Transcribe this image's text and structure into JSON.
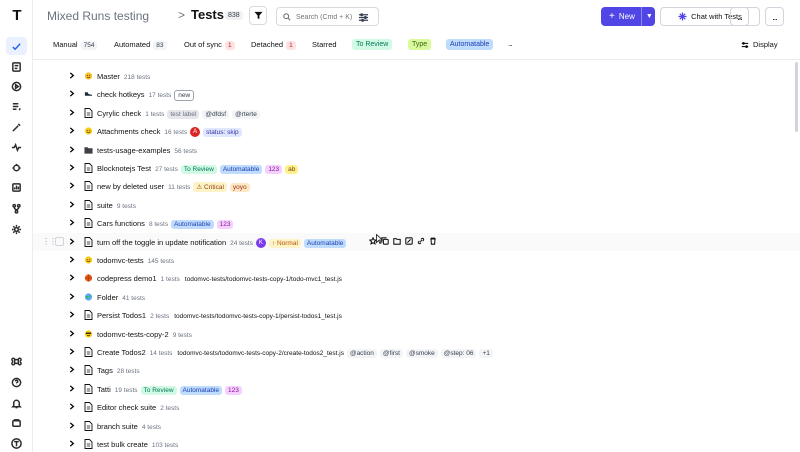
{
  "header": {
    "crumb": "Mixed Runs testing",
    "separator": ">",
    "title": "Tests",
    "count": "838",
    "search_placeholder": "Search (Cmd + K)",
    "new_label": "New",
    "chat_label": "Chat with Tests",
    "more_label": "...",
    "accent_color": "#4f46e5"
  },
  "rail": {
    "logo": "T",
    "items": [
      "check-icon",
      "clipboard-icon",
      "play-icon",
      "list-icon",
      "wand-icon",
      "pulse-icon",
      "bug-icon",
      "chart-icon",
      "branch-icon",
      "gear-icon"
    ],
    "bottom": [
      "command-icon",
      "help-icon",
      "bell-icon",
      "folders-icon",
      "user-logo-icon"
    ]
  },
  "tabs": [
    {
      "label": "Manual",
      "count": "754"
    },
    {
      "label": "Automated",
      "count": "83"
    },
    {
      "label": "Out of sync",
      "count": "1"
    },
    {
      "label": "Detached",
      "count": "1"
    },
    {
      "label": "Starred",
      "count": ""
    }
  ],
  "filters": [
    "To Review",
    "Type",
    "Automatable"
  ],
  "tabs_more": "...",
  "display_label": "Display",
  "rows": [
    {
      "icon": "sun-emoji-icon",
      "name": "Master",
      "meta": "218 tests",
      "tags": []
    },
    {
      "icon": "shoes-emoji-icon",
      "name": "check hotkeys",
      "meta": "17 tests",
      "tags": [
        "new"
      ]
    },
    {
      "icon": "file-icon",
      "name": "Cyrylic check",
      "meta": "1 tests",
      "tags": [
        "test label",
        "@dfdsf",
        "@rterte"
      ]
    },
    {
      "icon": "smile-emoji-icon",
      "name": "Attachments check",
      "meta": "16 tests",
      "avatar": "A",
      "tags": [
        "status: skip"
      ]
    },
    {
      "icon": "folder-icon",
      "name": "tests-usage-examples",
      "meta": "56 tests",
      "tags": []
    },
    {
      "icon": "file-icon",
      "name": "Blocknotejs Test",
      "meta": "27 tests",
      "tags": [
        "To Review",
        "Automatable",
        "123",
        "ab"
      ]
    },
    {
      "icon": "file-icon",
      "name": "new by deleted user",
      "meta": "11 tests",
      "tags": [
        "⚠ Critical",
        "yoyo"
      ]
    },
    {
      "icon": "file-icon",
      "name": "suite",
      "meta": "9 tests",
      "tags": []
    },
    {
      "icon": "file-icon",
      "name": "Cars functions",
      "meta": "8 tests",
      "tags": [
        "Automatable",
        "123"
      ]
    },
    {
      "icon": "file-icon",
      "name": "turn off the toggle in update notification",
      "meta": "24 tests",
      "avatar": "K",
      "tags": [
        "↑ Normal",
        "Automatable"
      ]
    },
    {
      "icon": "smile-emoji-icon",
      "name": "todomvc-tests",
      "meta": "145 tests",
      "tags": []
    },
    {
      "icon": "ball-emoji-icon",
      "name": "codepress demo1",
      "meta": "1 tests",
      "path": "todomvc-tests/todomvc-tests-copy-1/todo-mvc1_test.js",
      "tags": []
    },
    {
      "icon": "globe-emoji-icon",
      "name": "Folder",
      "meta": "41 tests",
      "tags": []
    },
    {
      "icon": "file-icon",
      "name": "Persist Todos1",
      "meta": "2 tests",
      "path": "todomvc-tests/todomvc-tests-copy-1/persist-todos1_test.js",
      "tags": []
    },
    {
      "icon": "cool-emoji-icon",
      "name": "todomvc-tests-copy-2",
      "meta": "9 tests",
      "tags": []
    },
    {
      "icon": "file-icon",
      "name": "Create Todos2",
      "meta": "14 tests",
      "path": "todomvc-tests/todomvc-tests-copy-2/create-todos2_test.js",
      "tags": [
        "@action",
        "@first",
        "@smoke",
        "@step: 06",
        "+1"
      ]
    },
    {
      "icon": "file-icon",
      "name": "Tags",
      "meta": "28 tests",
      "tags": []
    },
    {
      "icon": "file-icon",
      "name": "Tatti",
      "meta": "19 tests",
      "tags": [
        "To Review",
        "Automatable",
        "123"
      ]
    },
    {
      "icon": "file-icon",
      "name": "Editor check suite",
      "meta": "2 tests",
      "tags": []
    },
    {
      "icon": "file-icon",
      "name": "branch suite",
      "meta": "4 tests",
      "tags": []
    },
    {
      "icon": "file-icon",
      "name": "test bulk create",
      "meta": "103 tests",
      "tags": []
    }
  ]
}
